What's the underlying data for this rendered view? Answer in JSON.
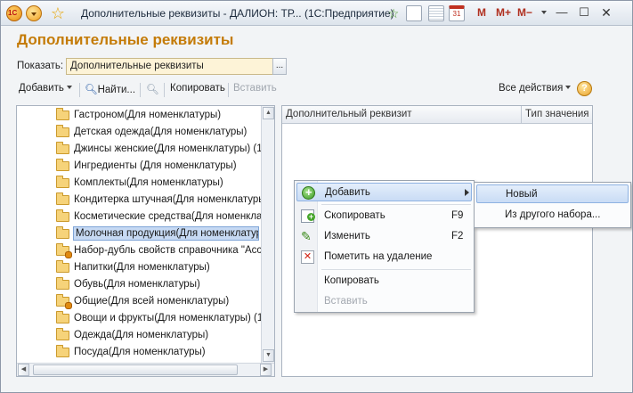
{
  "window": {
    "title": "Дополнительные реквизиты - ДАЛИОН: ТР...  (1С:Предприятие)",
    "m_buttons": [
      "M",
      "M+",
      "M−"
    ]
  },
  "form": {
    "title": "Дополнительные реквизиты",
    "show_label": "Показать:",
    "show_value": "Дополнительные реквизиты",
    "show_btn": "..."
  },
  "toolbar": {
    "add": "Добавить",
    "find": "Найти...",
    "copy": "Копировать",
    "paste": "Вставить",
    "all_actions": "Все действия",
    "help": "?"
  },
  "tree": {
    "items": [
      "Гастроном(Для номенклатуры)",
      "Детская одежда(Для номенклатуры)",
      "Джинсы женские(Для номенклатуры) (1)",
      "Ингредиенты (Для номенклатуры)",
      "Комплекты(Для номенклатуры)",
      "Кондитерка штучная(Для номенклатуры)",
      "Косметические средства(Для номенклатуры)",
      "Молочная продукция(Для номенклатуры)",
      "Набор-дубль свойств справочника \"Ассо",
      "Напитки(Для номенклатуры)",
      "Обувь(Для номенклатуры)",
      "Общие(Для всей номенклатуры)",
      "Овощи и фрукты(Для номенклатуры) (1)",
      "Одежда(Для номенклатуры)",
      "Посуда(Для номенклатуры)"
    ],
    "selected_index": 7
  },
  "props": {
    "col_attr": "Дополнительный реквизит",
    "col_type": "Тип значения"
  },
  "context_menu": {
    "add": "Добавить",
    "copy": "Скопировать",
    "copy_key": "F9",
    "edit": "Изменить",
    "edit_key": "F2",
    "mark_delete": "Пометить на удаление",
    "copy2": "Копировать",
    "paste": "Вставить"
  },
  "submenu": {
    "new": "Новый",
    "from_other": "Из другого набора..."
  }
}
